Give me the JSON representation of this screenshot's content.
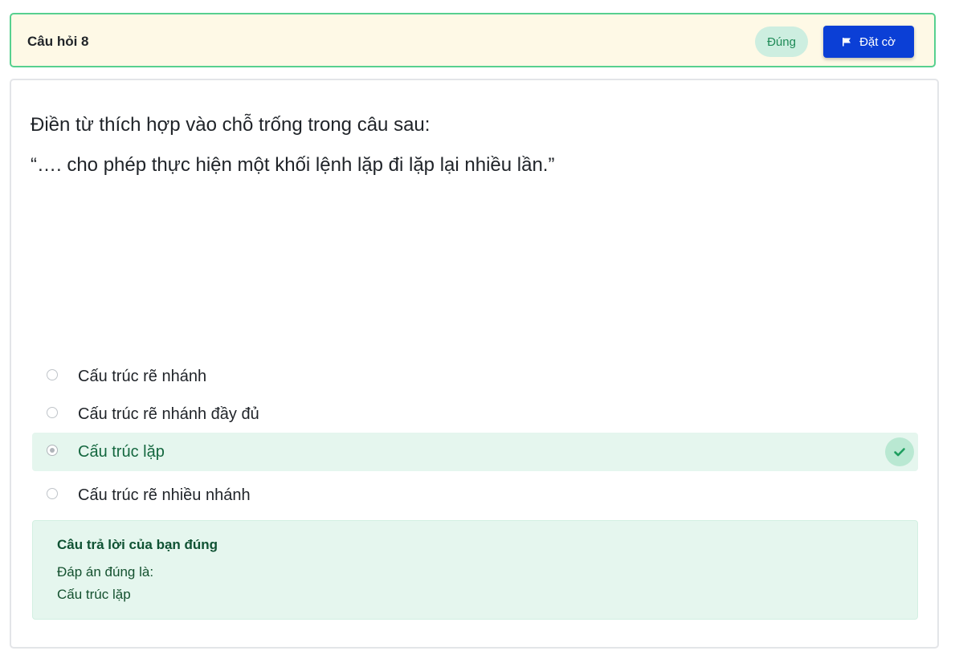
{
  "header": {
    "question_title": "Câu hỏi 8",
    "status": "Đúng",
    "flag_label": "Đặt cờ"
  },
  "question": {
    "line1": "Điền từ thích hợp vào chỗ trống trong câu sau:",
    "line2": "“…. cho phép thực hiện một khối lệnh lặp đi lặp lại nhiều lần.”"
  },
  "options": [
    {
      "label": "Cấu trúc rẽ nhánh",
      "selected": false
    },
    {
      "label": "Cấu trúc rẽ nhánh đầy đủ",
      "selected": false
    },
    {
      "label": "Cấu trúc lặp",
      "selected": true,
      "correct": true
    },
    {
      "label": "Cấu trúc rẽ nhiều nhánh",
      "selected": false
    }
  ],
  "feedback": {
    "title": "Câu trả lời của bạn đúng",
    "answer_intro": "Đáp án đúng là:",
    "answer": "Cấu trúc lặp"
  },
  "colors": {
    "accent": "#0b3fd6",
    "correct_green": "#1e9e5f",
    "header_border": "#57d08f",
    "header_bg": "#fef9e6",
    "feedback_bg": "#e5f6ee"
  },
  "icons": {
    "flag": "flag-icon",
    "correct": "check-icon"
  }
}
